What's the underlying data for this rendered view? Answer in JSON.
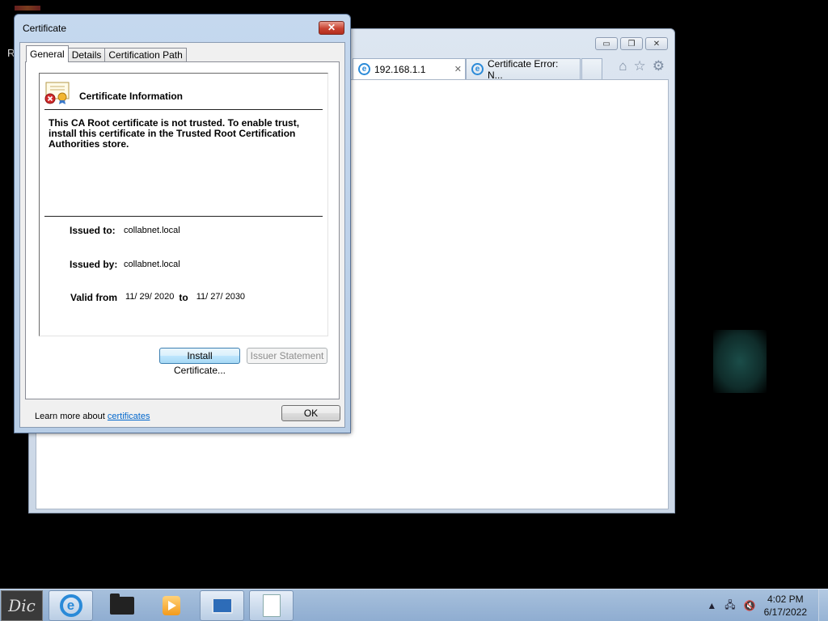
{
  "desktop": {
    "stray_letter": "R"
  },
  "browser": {
    "tabs": [
      {
        "label": "192.168.1.1",
        "close": "✕"
      },
      {
        "label": "Certificate Error: N..."
      }
    ],
    "window_controls": {
      "minimize": "▭",
      "restore": "❐",
      "close": "✕"
    },
    "toolbar_icons": [
      "home-icon",
      "favorites-star-icon",
      "tools-gear-icon"
    ]
  },
  "dialog": {
    "title": "Certificate",
    "close_glyph": "✕",
    "tabs": [
      "General",
      "Details",
      "Certification Path"
    ],
    "active_tab": "General",
    "heading": "Certificate Information",
    "warning": "This CA Root certificate is not trusted. To enable trust, install this certificate in the Trusted Root Certification Authorities store.",
    "issued_to_label": "Issued to:",
    "issued_to_value": "collabnet.local",
    "issued_by_label": "Issued by:",
    "issued_by_value": "collabnet.local",
    "valid_from_label": "Valid from",
    "valid_from": "11/ 29/ 2020",
    "to_label": "to",
    "valid_to": "11/ 27/ 2030",
    "install_button": "Install Certificate...",
    "issuer_statement_button": "Issuer Statement",
    "learn_more_prefix": "Learn more about ",
    "learn_more_link": "certificates",
    "ok_button": "OK"
  },
  "taskbar": {
    "start_label": "Dic",
    "clock_time": "4:02 PM",
    "clock_date": "6/17/2022",
    "tray_icons": [
      "show-hidden-icons-icon",
      "network-icon",
      "volume-muted-icon"
    ]
  }
}
